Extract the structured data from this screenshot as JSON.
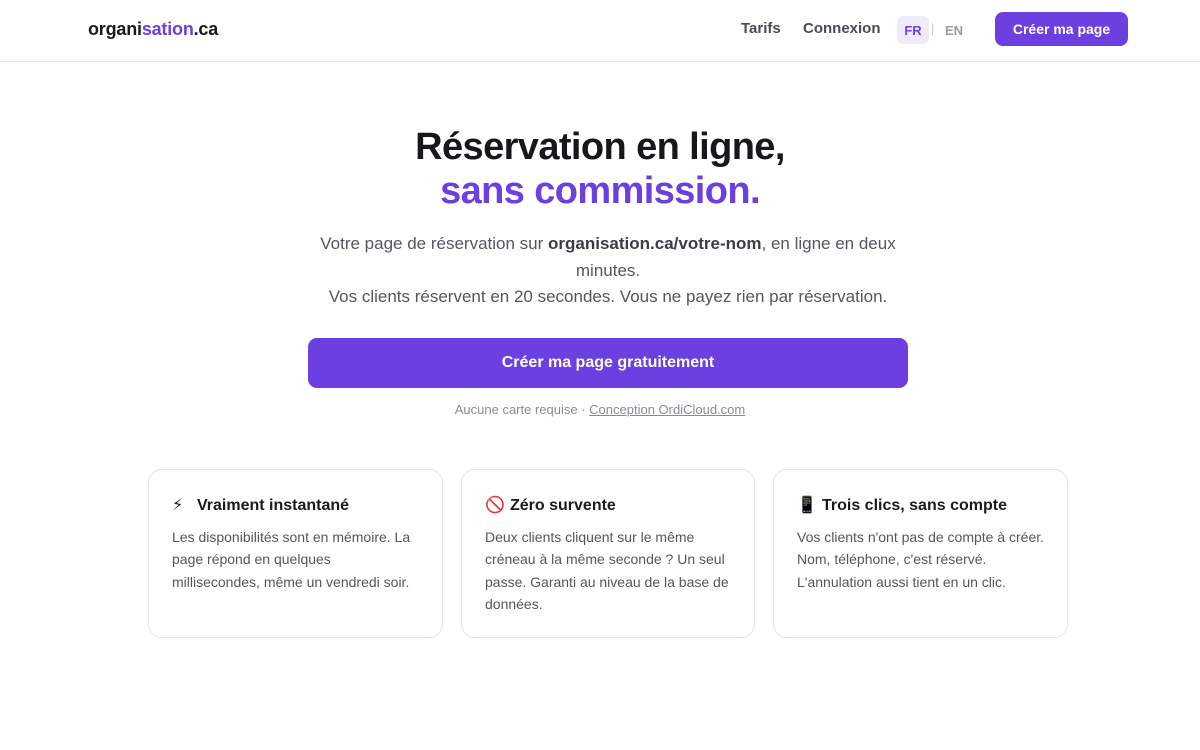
{
  "header": {
    "logo_part1": "organi",
    "logo_part2": "sation",
    "logo_part3": ".ca",
    "nav_tarifs": "Tarifs",
    "nav_connexion": "Connexion",
    "lang_fr": "FR",
    "lang_separator": "|",
    "lang_en": "EN",
    "cta_label": "Créer ma page"
  },
  "hero": {
    "title_line1": "Réservation en ligne,",
    "title_line2": "sans commission.",
    "subtitle_pre": "Votre page de réservation sur ",
    "subtitle_bold": "organisation.ca/votre-nom",
    "subtitle_post": ", en ligne en deux minutes.",
    "subtitle_line2": "Vos clients réservent en 20 secondes. Vous ne payez rien par réservation.",
    "cta_label": "Créer ma page gratuitement",
    "note_text": "Aucune carte requise · ",
    "note_link": "Conception OrdiCloud.com"
  },
  "features": [
    {
      "icon": "lightning-icon",
      "glyph": "⚡",
      "title": "Vraiment instantané",
      "text": "Les disponibilités sont en mémoire. La page répond en quelques millisecondes, même un vendredi soir."
    },
    {
      "icon": "prohibited-icon",
      "glyph": "🚫",
      "title": "Zéro survente",
      "text": "Deux clients cliquent sur le même créneau à la même seconde ? Un seul passe. Garanti au niveau de la base de données."
    },
    {
      "icon": "mobile-phone-icon",
      "glyph": "📱",
      "title": "Trois clics, sans compte",
      "text": "Vos clients n'ont pas de compte à créer. Nom, téléphone, c'est réservé. L'annulation aussi tient en un clic."
    }
  ],
  "colors": {
    "accent": "#6b3fe0",
    "accent_soft": "#efeafd",
    "text_dark": "#17171c",
    "text_muted": "#55555f",
    "border": "#e4e4ea"
  }
}
